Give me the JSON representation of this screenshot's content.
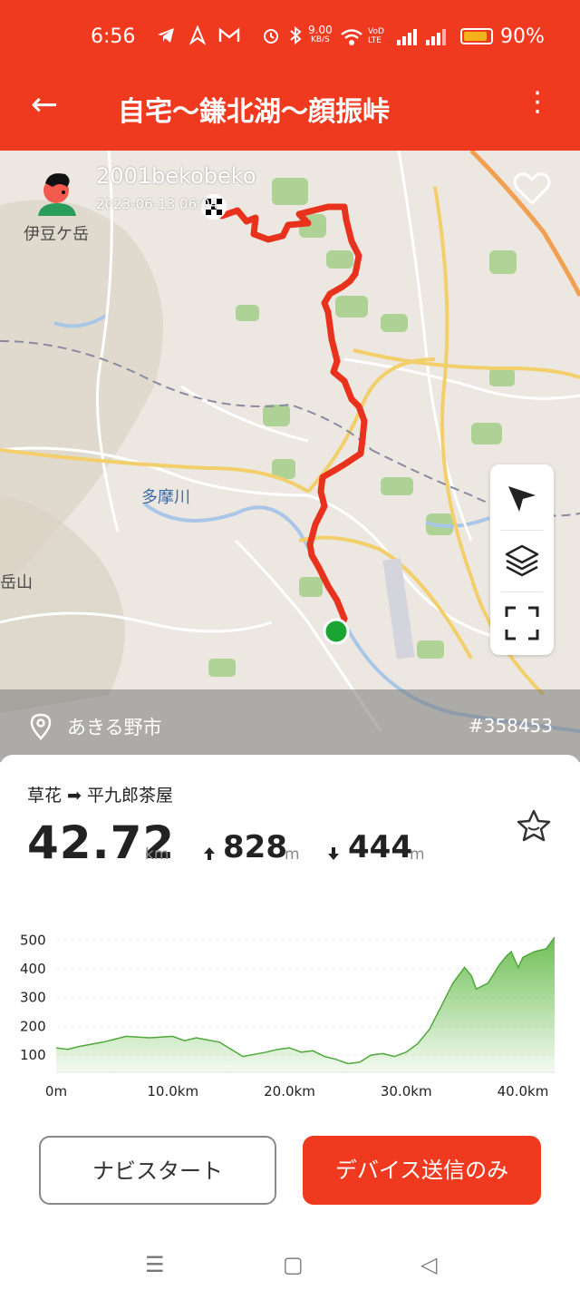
{
  "status_bar": {
    "time": "6:56",
    "net_speed_top": "9.00",
    "net_speed_bottom": "KB/S",
    "volte": "VoD LTE",
    "battery_percent": "90%",
    "battery_level": 0.9,
    "icons": [
      "telegram-icon",
      "navigation-icon",
      "gmail-icon",
      "alarm-icon",
      "bluetooth-icon",
      "wifi-icon",
      "signal-icon"
    ]
  },
  "app_bar": {
    "back_label": "←",
    "title": "自宅〜鎌北湖〜顔振峠",
    "menu_label": "⋮"
  },
  "map": {
    "username": "2001bekobeko",
    "date": "2023-06-13 06:04",
    "place_labels": [
      "伊豆ケ岳",
      "多摩川",
      "岳山"
    ],
    "location": "あきる野市",
    "route_id": "#358453"
  },
  "route_card": {
    "route_text": "草花 ➡ 平九郎茶屋",
    "distance_value": "42.72",
    "distance_unit": "km",
    "ascent_icon": "up-arrow-icon",
    "ascent_value": "828",
    "ascent_unit": "m",
    "descent_icon": "down-arrow-icon",
    "descent_value": "444",
    "descent_unit": "m"
  },
  "chart_data": {
    "type": "area",
    "title": "",
    "xlabel": "",
    "ylabel": "",
    "x_ticks": [
      "0m",
      "10.0km",
      "20.0km",
      "30.0km",
      "40.0km"
    ],
    "y_ticks": [
      "500",
      "400",
      "300",
      "200",
      "100"
    ],
    "xlim": [
      0,
      42.72
    ],
    "ylim": [
      40,
      520
    ],
    "x": [
      0,
      1,
      2,
      4,
      6,
      8,
      10,
      11,
      12,
      14,
      16,
      18,
      19,
      20,
      21,
      22,
      23,
      24,
      25,
      26,
      27,
      28,
      29,
      30,
      31,
      32,
      33,
      34,
      35,
      35.6,
      36,
      37,
      38,
      38.6,
      39,
      39.6,
      40,
      41,
      42,
      42.72
    ],
    "values": [
      125,
      120,
      130,
      145,
      165,
      160,
      165,
      150,
      160,
      145,
      95,
      110,
      120,
      125,
      110,
      115,
      95,
      85,
      70,
      75,
      100,
      105,
      95,
      110,
      140,
      190,
      270,
      350,
      405,
      375,
      330,
      350,
      415,
      445,
      460,
      405,
      440,
      460,
      470,
      510
    ],
    "color": "#6fbf55"
  },
  "buttons": {
    "navi_start": "ナビスタート",
    "send_device": "デバイス送信のみ"
  },
  "nav_bar": {
    "menu": "☰",
    "home": "▢",
    "back": "◁"
  }
}
